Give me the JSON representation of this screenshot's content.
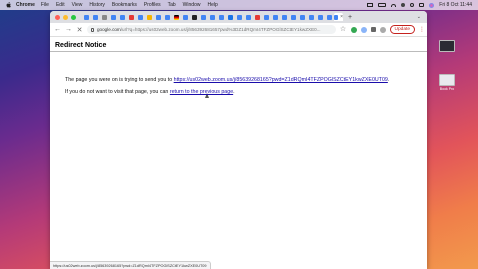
{
  "menubar": {
    "app_name": "Chrome",
    "items": [
      "File",
      "Edit",
      "View",
      "History",
      "Bookmarks",
      "Profiles",
      "Tab",
      "Window",
      "Help"
    ],
    "clock": "Fri 8 Oct  11:44"
  },
  "desktop": {
    "items": [
      {
        "label": "Book Pro"
      },
      {
        "label": ""
      }
    ]
  },
  "browser": {
    "address": {
      "domain": "google.com",
      "path": "/url?q=https://us02web.zoom.us/j/856392681657pwd%3DZ1dRQmI4TFZPOGlSZCtEY1kwZXE0..."
    },
    "update_label": "Update",
    "new_tab_symbol": "+",
    "tabs_chevron": "⌄"
  },
  "page": {
    "title": "Redirect Notice",
    "line1_prefix": "The page you were on is trying to send you to ",
    "redirect_url": "https://us02web.zoom.us/j/85639268165?pwd=Z1dRQmI4TFZPOGlSZCtEY1kwZXE0UT09",
    "line1_suffix": ".",
    "line2_prefix": "If you do not want to visit that page, you can ",
    "return_link": "return to the previous page",
    "line2_suffix": "."
  },
  "status_bar": {
    "text": "https://us02web.zoom.us/j/85639268165?pwd=Z1dRQmI4TFZPOGlSZCtEY1kwZXE0UT09"
  },
  "colors": {
    "link": "#1a0dab",
    "update_accent": "#c5221f"
  }
}
